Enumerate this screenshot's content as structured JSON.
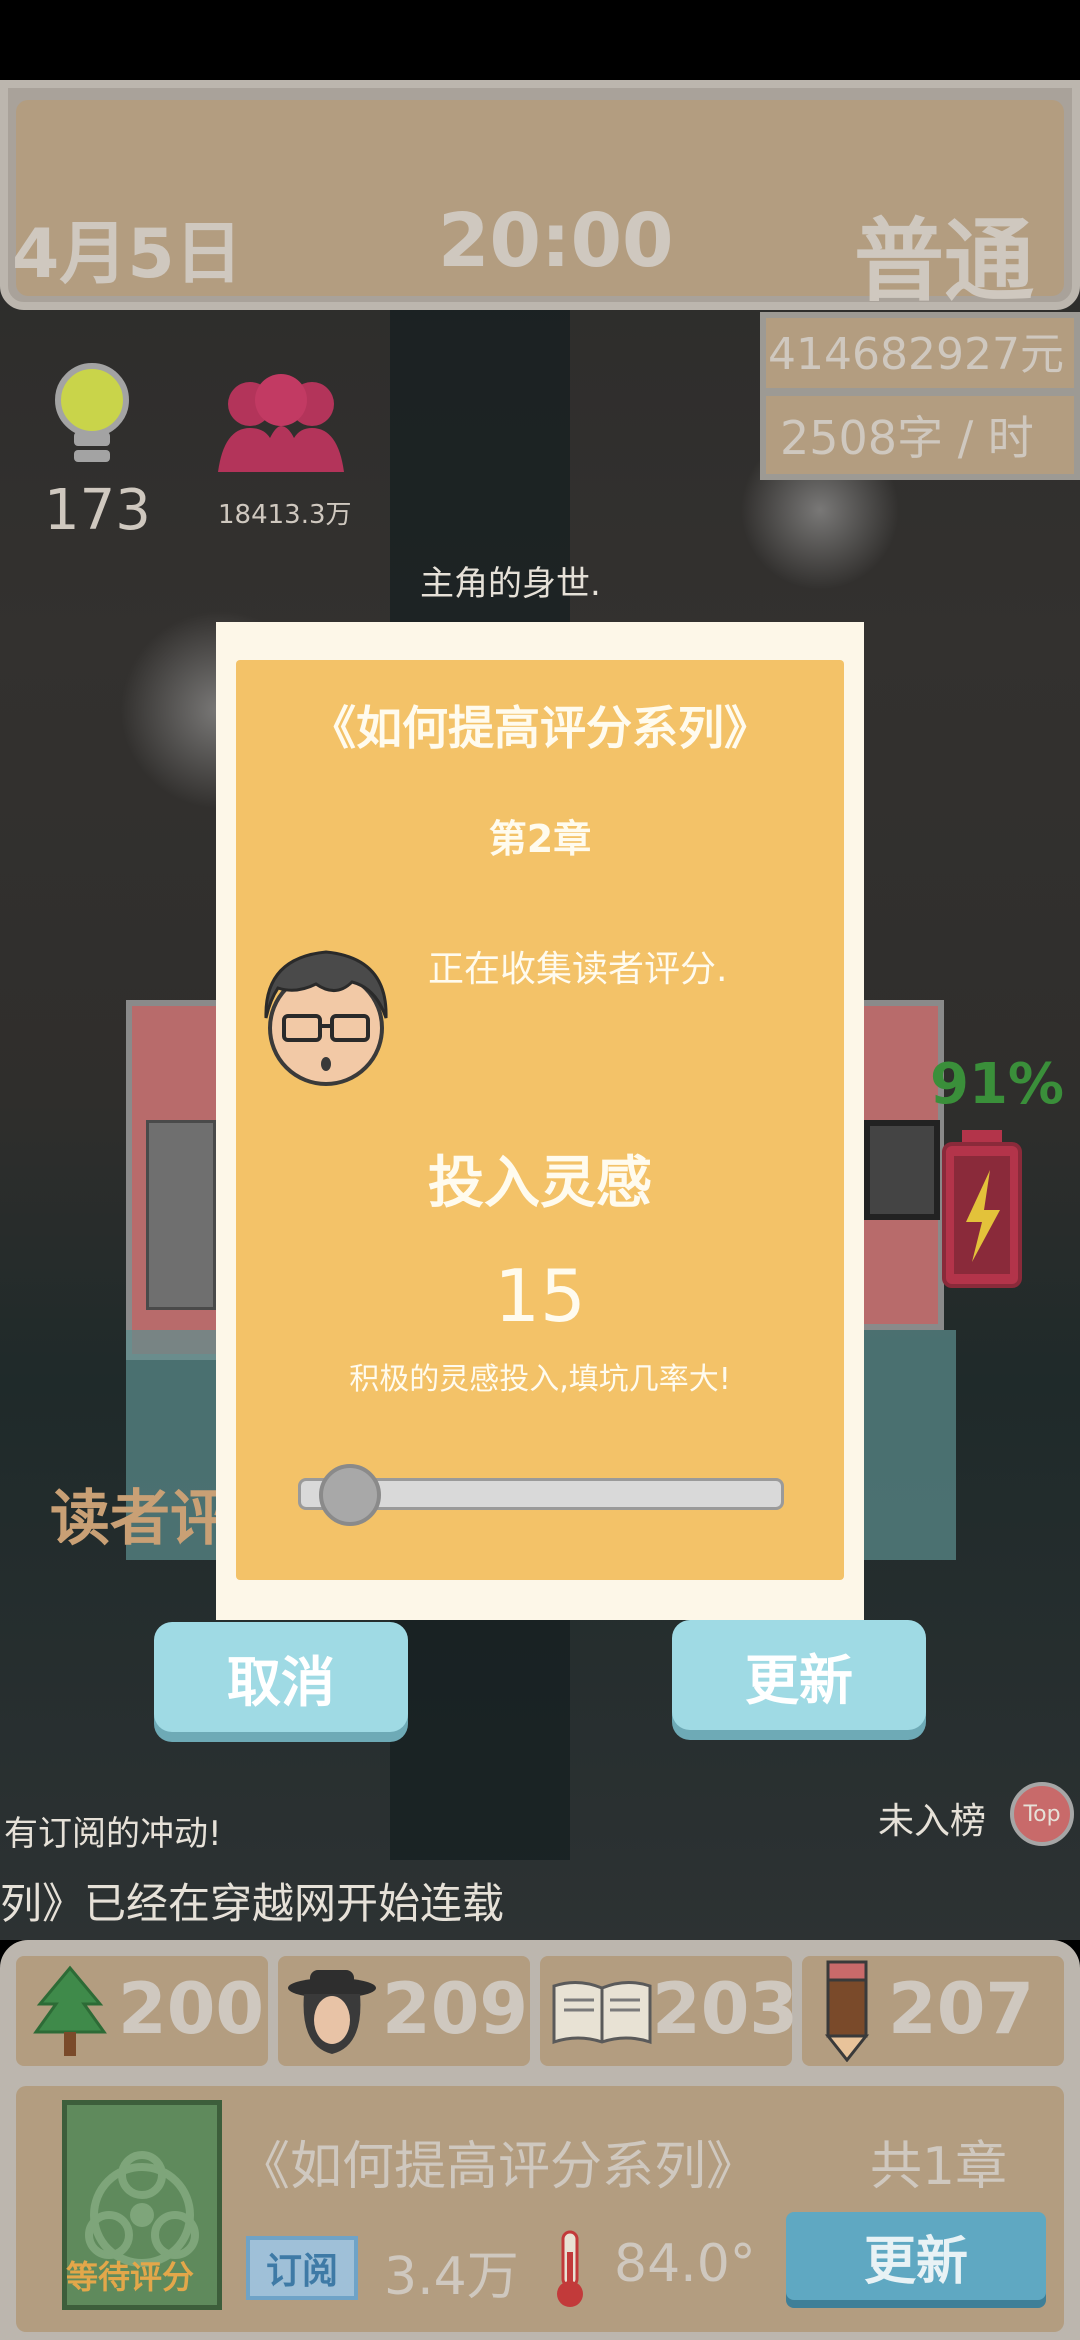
{
  "top_bar": {
    "date": "4月5日",
    "time": "20:00",
    "difficulty": "普通",
    "money": "414682927元",
    "speed": "2508字 / 时"
  },
  "stats": {
    "inspiration": "173",
    "fans": "18413.3万",
    "battery": "91%"
  },
  "scene": {
    "caption": "主角的身世.",
    "reader_label_partial": "读者评",
    "comment_partial": "有订阅的冲动!",
    "rank_label": "未入榜",
    "top_badge": "Top",
    "ticker": "列》已经在穿越网开始连载"
  },
  "dialog": {
    "title": "《如何提高评分系列》",
    "chapter": "第2章",
    "status": "正在收集读者评分.",
    "invest_label": "投入灵感",
    "invest_value": "15",
    "hint": "积极的灵感投入,填坑几率大!",
    "slider_fraction": 0.05,
    "cancel_label": "取消",
    "update_label": "更新"
  },
  "bottom": {
    "attributes": [
      {
        "icon": "tree-icon",
        "value": "200"
      },
      {
        "icon": "character-icon",
        "value": "209"
      },
      {
        "icon": "book-icon",
        "value": "203"
      },
      {
        "icon": "pencil-icon",
        "value": "207"
      }
    ],
    "book": {
      "cover_status": "等待评分",
      "title": "《如何提高评分系列》",
      "chapters": "共1章",
      "subscribe_badge": "订阅",
      "subscribers": "3.4万",
      "heat": "84.0°",
      "update_label": "更新"
    }
  },
  "colors": {
    "dialog_bg": "#f3c268",
    "button_bg": "#9fdae4",
    "panel_bg": "#b39d80",
    "battery_green": "#3a8f3a",
    "fans_red": "#b3345a"
  }
}
